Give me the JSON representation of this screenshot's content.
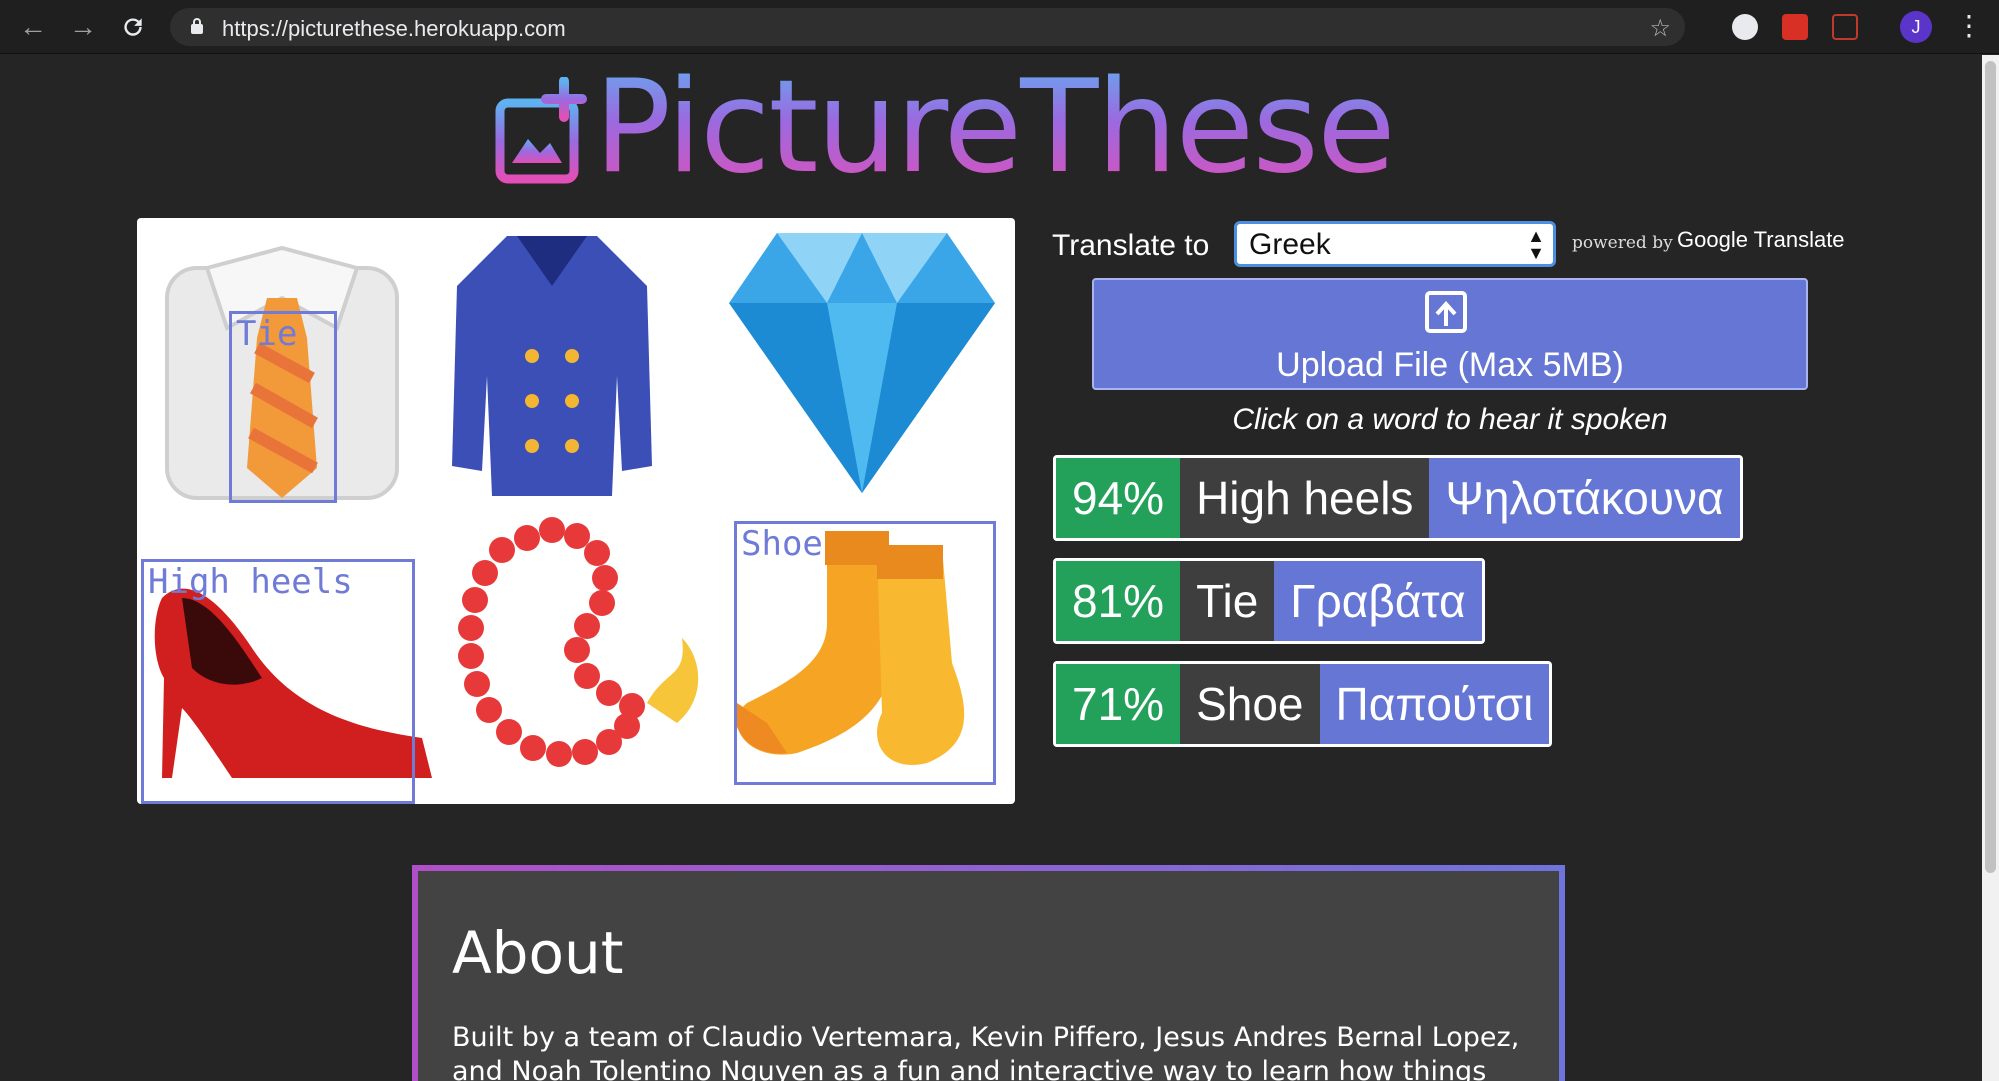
{
  "browser": {
    "url": "https://picturethese.herokuapp.com",
    "avatar_letter": "J"
  },
  "logo": {
    "text": "PictureThese"
  },
  "translate": {
    "label": "Translate to",
    "selected_language": "Greek",
    "powered_by": "powered by",
    "provider": "Google Translate"
  },
  "upload": {
    "label": "Upload File (Max 5MB)"
  },
  "hint": "Click on a word to hear it spoken",
  "detections": [
    {
      "label": "Tie"
    },
    {
      "label": "High heels"
    },
    {
      "label": "Shoe"
    }
  ],
  "results": [
    {
      "percent": "94%",
      "word": "High heels",
      "translation": "Ψηλοτάκουνα"
    },
    {
      "percent": "81%",
      "word": "Tie",
      "translation": "Γραβάτα"
    },
    {
      "percent": "71%",
      "word": "Shoe",
      "translation": "Παπούτσι"
    }
  ],
  "about": {
    "title": "About",
    "body": "Built by a team of Claudio Vertemara, Kevin Piffero, Jesus Andres Bernal Lopez, and Noah Tolentino Nguyen as a fun and interactive way to learn how things are said in"
  },
  "colors": {
    "accent": "#6576d4",
    "confidence": "#23a15a",
    "word_bg": "#3e3e3e",
    "bbox": "#6f7bd6"
  }
}
